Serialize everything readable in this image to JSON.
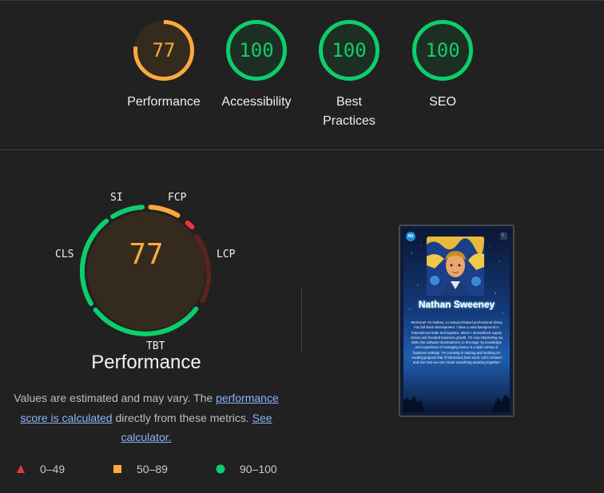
{
  "summary_gauges": [
    {
      "label": "Performance",
      "score": "77",
      "value": 77,
      "color": "#fbaa3b",
      "fill": "#342a1e"
    },
    {
      "label": "Accessibility",
      "score": "100",
      "value": 100,
      "color": "#0cce6b",
      "fill": "#1d2f22"
    },
    {
      "label": "Best Practices",
      "score": "100",
      "value": 100,
      "color": "#0cce6b",
      "fill": "#1d2f22"
    },
    {
      "label": "SEO",
      "score": "100",
      "value": 100,
      "color": "#0cce6b",
      "fill": "#1d2f22"
    }
  ],
  "performance": {
    "score": "77",
    "title": "Performance",
    "metrics": {
      "si": "SI",
      "fcp": "FCP",
      "lcp": "LCP",
      "tbt": "TBT",
      "cls": "CLS"
    },
    "colors": {
      "pass": "#0cce6b",
      "average": "#fbaa3b",
      "fail": "#e8383b",
      "fail_dim": "#5a2320",
      "inner": "#342a1e"
    }
  },
  "note": {
    "prefix": "Values are estimated and may vary. The",
    "link_score": "performance score is calculated",
    "middle": "directly from these metrics.",
    "link_calc": "See calculator."
  },
  "legend": [
    {
      "symbol": "triangle",
      "label": "0–49",
      "color": "#e8383b"
    },
    {
      "symbol": "square",
      "label": "50–89",
      "color": "#fbaa3b"
    },
    {
      "symbol": "circle",
      "label": "90–100",
      "color": "#0cce6b"
    }
  ],
  "screenshot": {
    "badge": "NS",
    "moon": "☾",
    "name": "Nathan Sweeney",
    "bio": "Welcome! I'm Nathan, a Liverpool-based professional diving into full stack development. I have a solid background in international trade and logistics, where I streamlined supply chains and boosted business growth. I'm now channeling my skills into software development, to leverage my knowledge and experience of managing teams in a wide variety of business settings. I'm currently in training and working on exciting projects that I'll showcase here soon. Let's connect and see how we can create something amazing together!"
  }
}
